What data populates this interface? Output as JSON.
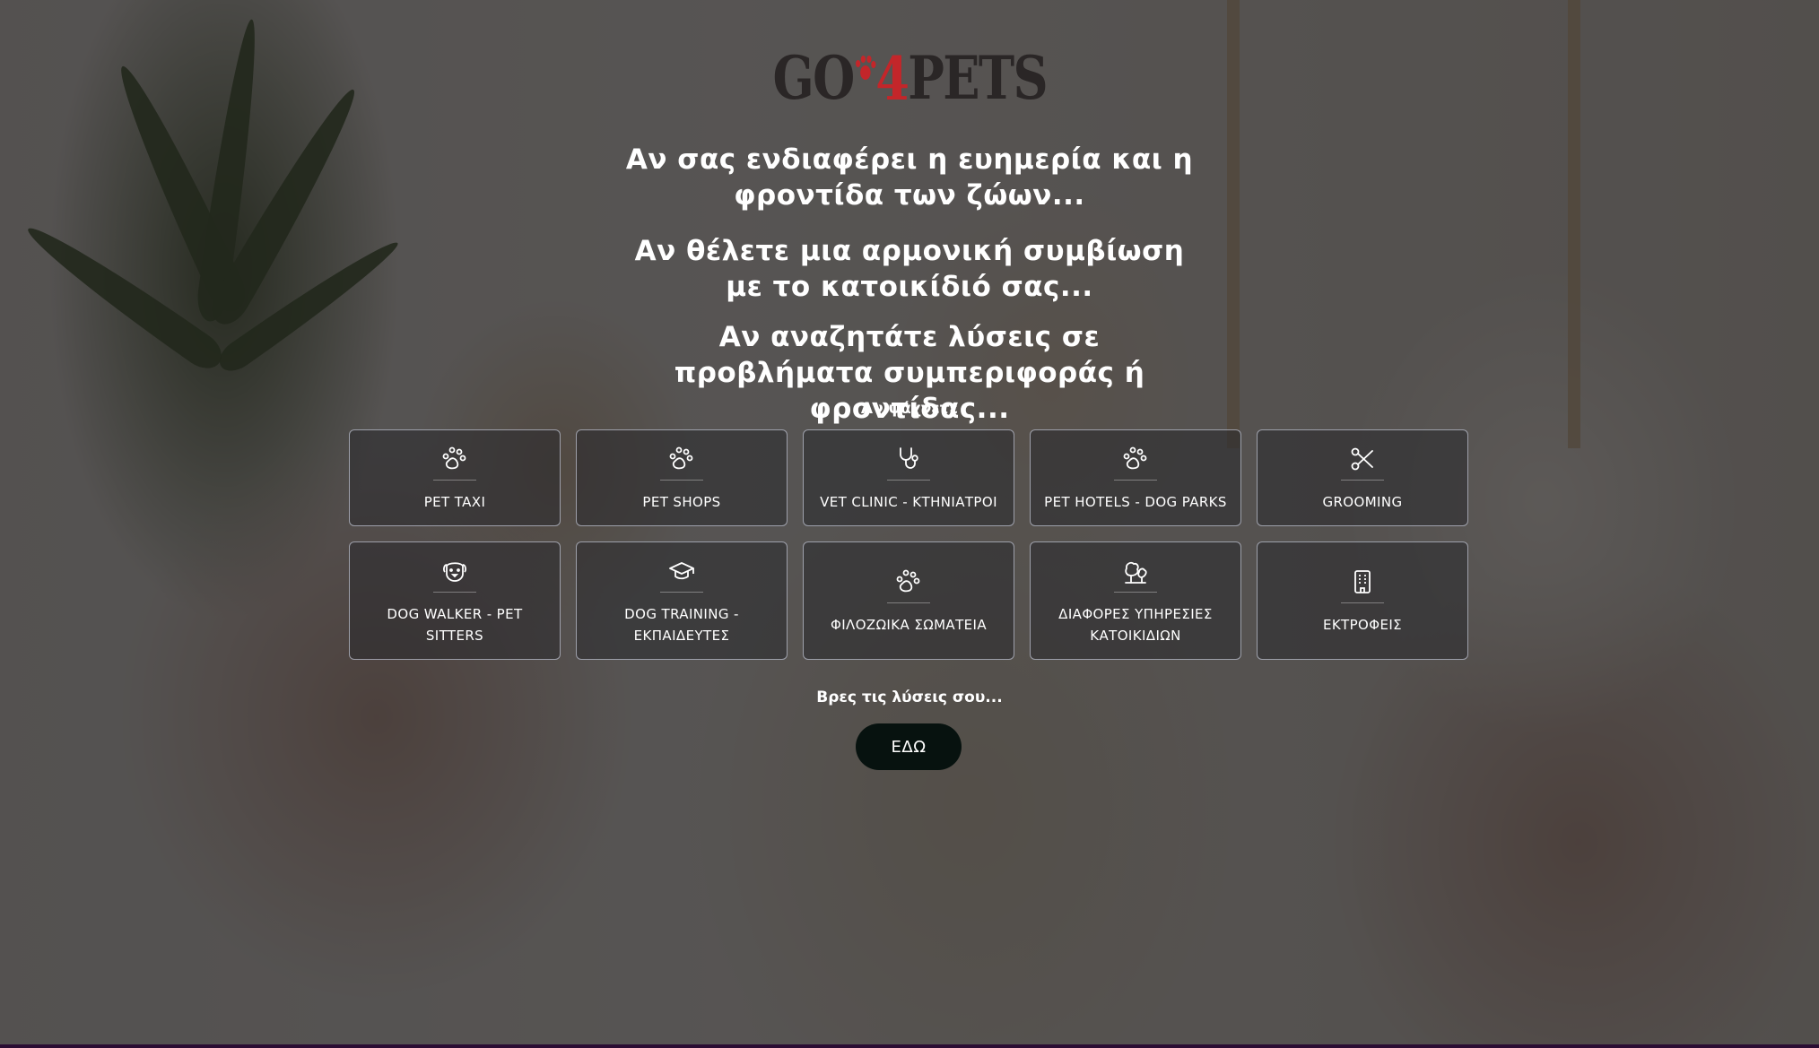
{
  "brand": {
    "logo_part1": "GO",
    "logo_part2": "4",
    "logo_part3": "PETS",
    "logo_color": "#2a2626",
    "accent_color": "#c3262a"
  },
  "hero": {
    "line1": "Αν σας ενδιαφέρει η ευημερία και η φροντίδα των ζώων...",
    "line2": "Αν θέλετε μια αρμονική συμβίωση με το κατοικίδιό σας...",
    "line3": "Αν αναζητάτε λύσεις σε προβλήματα συμπεριφοράς ή φροντίδας..."
  },
  "search_label": "Αν ψάχνετε",
  "categories_row1": [
    {
      "label": "PET TAXI",
      "icon": "paw-icon"
    },
    {
      "label": "PET SHOPS",
      "icon": "paw-icon"
    },
    {
      "label": "VET CLINIC - ΚΤΗΝΙΑΤΡΟΙ",
      "icon": "stethoscope-icon"
    },
    {
      "label": "PET HOTELS - DOG PARKS",
      "icon": "paw-icon"
    },
    {
      "label": "GROOMING",
      "icon": "scissors-icon"
    }
  ],
  "categories_row2": [
    {
      "label": "DOG WALKER - PET SITTERS",
      "icon": "dog-face-icon"
    },
    {
      "label": "DOG TRAINING - ΕΚΠΑΙΔΕΥΤΕΣ",
      "icon": "graduation-cap-icon"
    },
    {
      "label": "ΦΙΛΟΖΩΙΚΑ ΣΩΜΑΤΕΙΑ",
      "icon": "paw-icon"
    },
    {
      "label": "ΔΙΑΦΟΡΕΣ ΥΠΗΡΕΣΙΕΣ ΚΑΤΟΙΚΙΔΙΩΝ",
      "icon": "trees-icon"
    },
    {
      "label": "ΕΚΤΡΟΦΕΙΣ",
      "icon": "building-icon"
    }
  ],
  "cta": {
    "text": "Βρες τις λύσεις σου...",
    "button_label": "ΕΔΩ",
    "button_color": "#07120f"
  }
}
